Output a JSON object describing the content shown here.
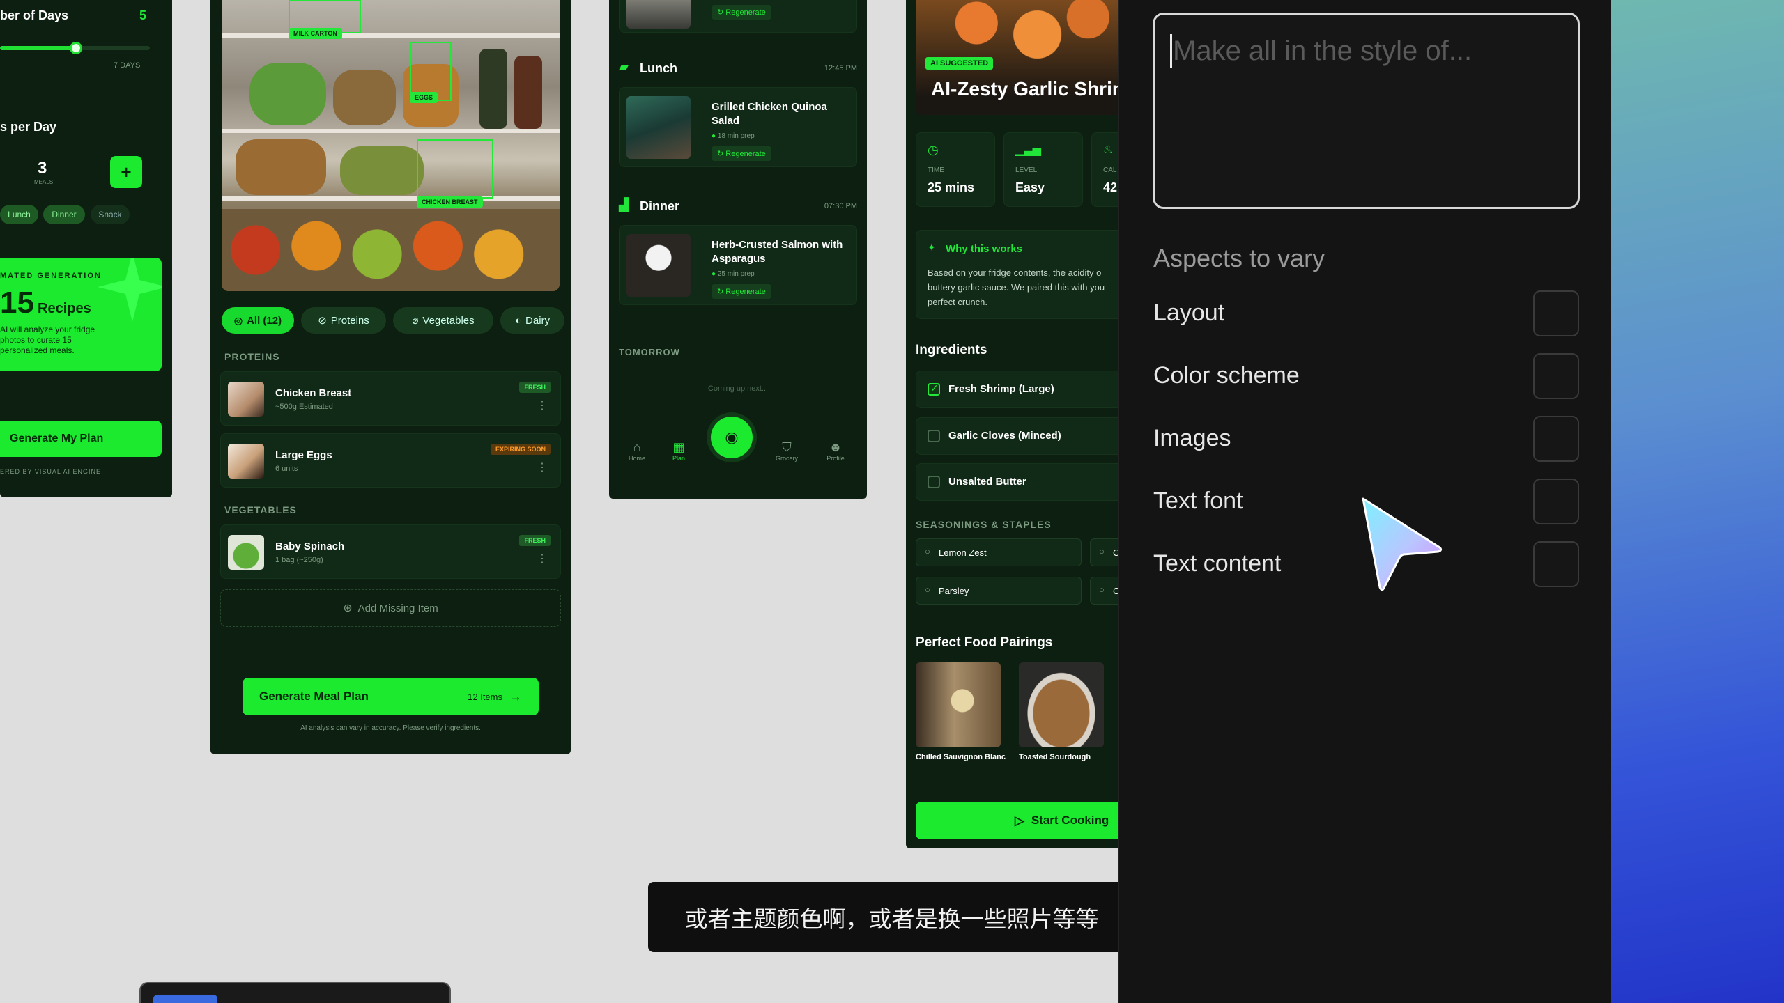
{
  "card1": {
    "days_label": "ber of Days",
    "days_value": "5",
    "days_caption": "7 DAYS",
    "meals_label": "s per Day",
    "meals_value": "3",
    "meals_unit": "MEALS",
    "plus": "+",
    "chips": [
      "Lunch",
      "Dinner",
      "Snack"
    ],
    "gen_label": "MATED GENERATION",
    "gen_number": "15",
    "gen_unit": "Recipes",
    "gen_desc": "AI will analyze your fridge photos to curate 15 personalized meals.",
    "cta": "Generate My Plan",
    "footer": "ERED BY VISUAL AI ENGINE"
  },
  "card2": {
    "detect": [
      "MILK CARTON",
      "EGGS",
      "CHICKEN BREAST"
    ],
    "filters": [
      "All (12)",
      "Proteins",
      "Vegetables",
      "Dairy"
    ],
    "sec_proteins": "PROTEINS",
    "sec_vegetables": "VEGETABLES",
    "items": [
      {
        "name": "Chicken Breast",
        "sub": "~500g Estimated",
        "tag": "FRESH"
      },
      {
        "name": "Large Eggs",
        "sub": "6 units",
        "tag": "EXPIRING SOON"
      },
      {
        "name": "Baby Spinach",
        "sub": "1 bag (~250g)",
        "tag": "FRESH"
      }
    ],
    "add_missing": "Add Missing Item",
    "cta": "Generate Meal Plan",
    "cta_count": "12 Items",
    "disclaimer": "AI analysis can vary in accuracy. Please verify ingredients."
  },
  "card3": {
    "regen": "Regenerate",
    "lunch": "Lunch",
    "lunch_time": "12:45 PM",
    "lunch_meal": "Grilled Chicken Quinoa Salad",
    "lunch_prep": "18 min prep",
    "dinner": "Dinner",
    "dinner_time": "07:30 PM",
    "dinner_meal": "Herb-Crusted Salmon with Asparagus",
    "dinner_prep": "25 min prep",
    "tomorrow": "TOMORROW",
    "coming": "Coming up next...",
    "nav": [
      "Home",
      "Plan",
      "Grocery",
      "Profile"
    ]
  },
  "card4": {
    "badge": "AI SUGGESTED",
    "title": "AI-Zesty Garlic Shrim",
    "stats": [
      {
        "label": "TIME",
        "value": "25 mins"
      },
      {
        "label": "LEVEL",
        "value": "Easy"
      },
      {
        "label": "CAL",
        "value": "42"
      }
    ],
    "why_title": "Why this works",
    "why_text": "Based on your fridge contents, the acidity o buttery garlic sauce. We paired this with you perfect crunch.",
    "ingredients_title": "Ingredients",
    "ingredients": [
      "Fresh Shrimp (Large)",
      "Garlic Cloves (Minced)",
      "Unsalted Butter"
    ],
    "seasonings_title": "SEASONINGS & STAPLES",
    "seasonings": [
      "Lemon Zest",
      "C",
      "Parsley",
      "C"
    ],
    "pairings_title": "Perfect Food Pairings",
    "pairings": [
      "Chilled Sauvignon Blanc",
      "Toasted Sourdough"
    ],
    "cta": "Start Cooking"
  },
  "panel": {
    "placeholder": "Make all in the style of...",
    "aspects_title": "Aspects to vary",
    "aspects": [
      "Layout",
      "Color scheme",
      "Images",
      "Text font",
      "Text content"
    ]
  },
  "subtitle": "或者主题颜色啊，或者是换一些照片等等"
}
